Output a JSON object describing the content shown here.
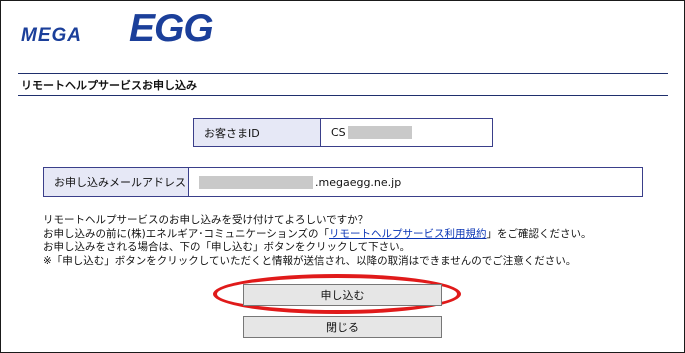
{
  "brand": {
    "mega": "MEGA",
    "egg": "EGG",
    "color": "#1b3f9a"
  },
  "page": {
    "section_title": "リモートヘルプサービスお申し込み"
  },
  "customer_id": {
    "label": "お客さまID",
    "prefix": "CS"
  },
  "email": {
    "label": "お申し込みメールアドレス",
    "domain": ".megaegg.ne.jp"
  },
  "message": {
    "line1": "リモートヘルプサービスのお申し込みを受け付けてよろしいですか？",
    "line2_before": "お申し込みの前に(株)エネルギア･コミュニケーションズの「",
    "line2_link": "リモートヘルプサービス利用規約",
    "line2_after": "」をご確認ください。",
    "line3": "お申し込みをされる場合は、下の「申し込む」ボタンをクリックして下さい。",
    "line4": "※「申し込む」ボタンをクリックしていただくと情報が送信され、以降の取消はできませんのでご注意ください。"
  },
  "buttons": {
    "apply": "申し込む",
    "close": "閉じる"
  },
  "colors": {
    "highlight_ellipse": "#e01a1a",
    "link": "#0a35b5",
    "label_bg": "#e6e8f6"
  }
}
